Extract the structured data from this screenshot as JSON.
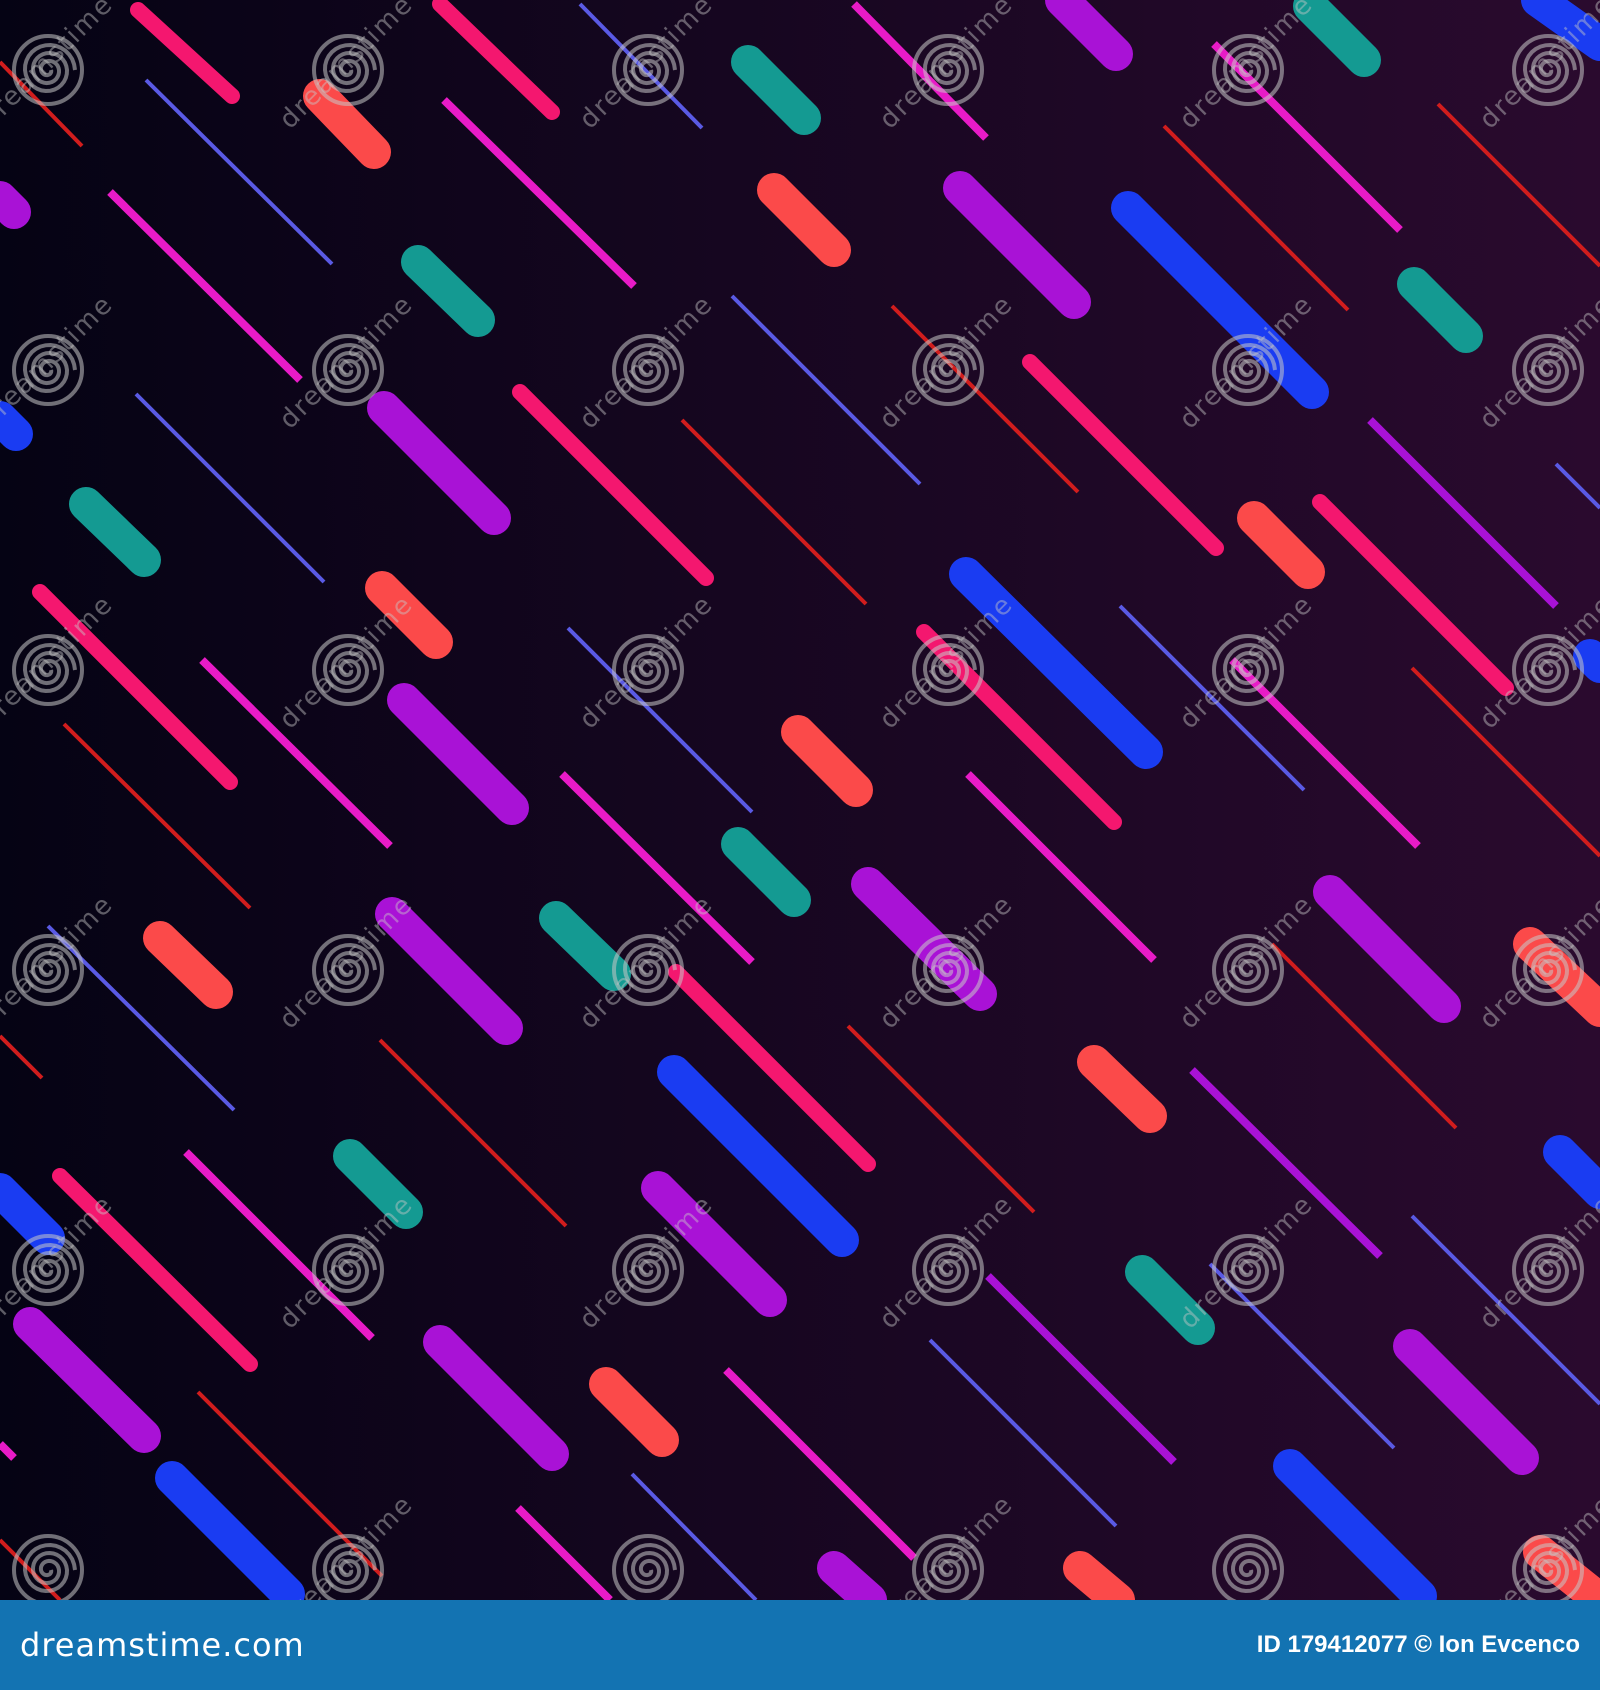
{
  "colors": {
    "background_left": "#050314",
    "background_right": "#2a0a2e",
    "footer_bar": "#1373b2",
    "pink": "#f4176f",
    "magenta": "#e81bc7",
    "purple": "#a912d6",
    "blue": "#1a3cf2",
    "teal": "#149a92",
    "coral": "#fb4a4a",
    "thin_blue": "#5a5ae4",
    "thin_red": "#d11d1d",
    "watermark": "#c8c8c8"
  },
  "icons": {
    "watermark": "spiral-logo-icon"
  },
  "watermark": {
    "text": "dreamstime"
  },
  "footer": {
    "site": "dreamstime.com",
    "credit": "ID 179412077 © Ion Evcenco"
  }
}
